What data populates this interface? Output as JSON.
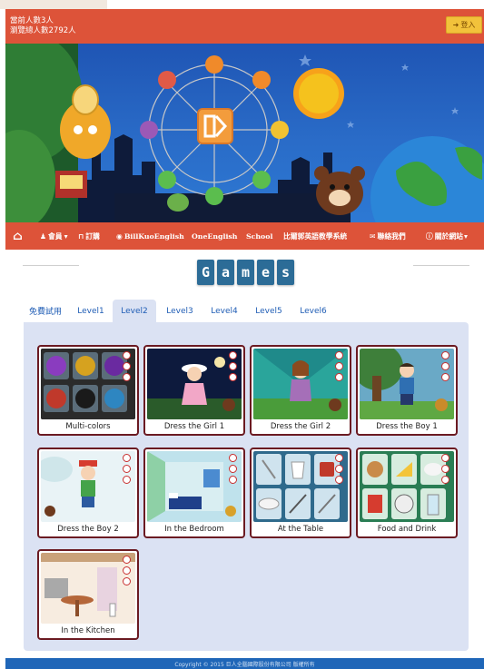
{
  "status": {
    "online_text": "當前人數3人",
    "total_text": "瀏覽總人數2792人",
    "login_label": "登入"
  },
  "nav": {
    "items": [
      {
        "label": "會員"
      },
      {
        "label": "訂購"
      },
      {
        "label": "BillKuoEnglish"
      },
      {
        "label": "OneEnglish"
      },
      {
        "label": "School"
      },
      {
        "label": "比爾郭英語教學系統"
      },
      {
        "label": "聯絡我們"
      },
      {
        "label": "關於網站"
      }
    ]
  },
  "games_title": [
    "G",
    "a",
    "m",
    "e",
    "s"
  ],
  "tabs": [
    {
      "label": "免費試用"
    },
    {
      "label": "Level1"
    },
    {
      "label": "Level2"
    },
    {
      "label": "Level3"
    },
    {
      "label": "Level4"
    },
    {
      "label": "Level5"
    },
    {
      "label": "Level6"
    }
  ],
  "active_tab": "Level2",
  "games": [
    {
      "title": "Multi-colors"
    },
    {
      "title": "Dress the Girl 1"
    },
    {
      "title": "Dress the Girl 2"
    },
    {
      "title": "Dress the Boy 1"
    },
    {
      "title": "Dress the Boy 2"
    },
    {
      "title": "In the Bedroom"
    },
    {
      "title": "At the Table"
    },
    {
      "title": "Food and Drink"
    },
    {
      "title": "In the Kitchen"
    }
  ],
  "footer": {
    "text": "Copyright © 2015 巨人全腦國際股份有限公司 版權所有"
  },
  "colors": {
    "brand_red": "#dd5339",
    "tab_blue": "#1f5db5",
    "panel_bg": "#dbe2f3",
    "card_border": "#6b1a22",
    "footer_blue": "#1f66b8"
  }
}
